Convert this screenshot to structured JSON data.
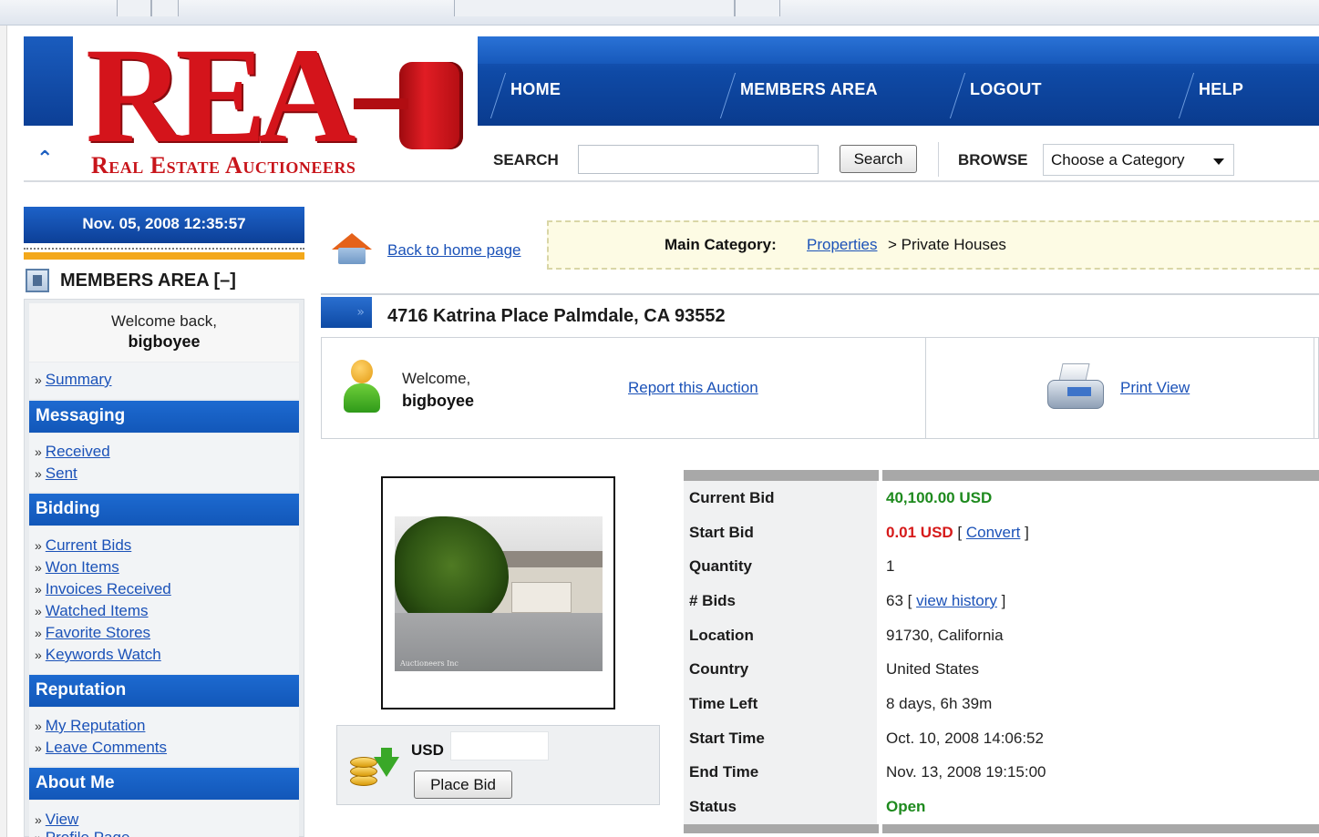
{
  "header": {
    "logo_text": "REA",
    "logo_subtitle": "Real Estate Auctioneers",
    "nav": [
      "HOME",
      "MEMBERS AREA",
      "LOGOUT",
      "HELP"
    ],
    "search_label": "SEARCH",
    "search_value": "",
    "search_button": "Search",
    "browse_label": "BROWSE",
    "category_selected": "Choose a Category"
  },
  "sidebar": {
    "datetime": "Nov. 05, 2008 12:35:57",
    "members_title": "MEMBERS AREA [–]",
    "welcome_line": "Welcome back,",
    "username": "bigboyee",
    "summary_link": "Summary",
    "sections": [
      {
        "title": "Messaging",
        "links": [
          "Received",
          "Sent"
        ]
      },
      {
        "title": "Bidding",
        "links": [
          "Current Bids",
          "Won Items",
          "Invoices Received",
          "Watched Items",
          "Favorite Stores",
          "Keywords Watch"
        ]
      },
      {
        "title": "Reputation",
        "links": [
          "My Reputation",
          "Leave Comments"
        ]
      },
      {
        "title": "About Me",
        "links": [
          "View",
          "Profile Page"
        ]
      }
    ]
  },
  "main": {
    "back_link": "Back to home page",
    "category_label": "Main Category:",
    "category_link": "Properties",
    "category_rest": "> Private Houses",
    "title": "4716 Katrina Place Palmdale, CA 93552",
    "welcome_line": "Welcome,",
    "username": "bigboyee",
    "report_link": "Report this Auction",
    "print_link": "Print View",
    "photo_watermark": "Auctioneers Inc",
    "bid_currency": "USD",
    "bid_value": "",
    "place_bid_button": "Place Bid",
    "details": {
      "current_bid_label": "Current Bid",
      "current_bid": "40,100.00 USD",
      "start_bid_label": "Start Bid",
      "start_bid": "0.01 USD",
      "convert_link": "Convert",
      "quantity_label": "Quantity",
      "quantity": "1",
      "bids_label": "# Bids",
      "bids": "63",
      "history_link": "view history",
      "location_label": "Location",
      "location": "91730, California",
      "country_label": "Country",
      "country": "United States",
      "time_left_label": "Time Left",
      "time_left": "8 days, 6h 39m",
      "start_time_label": "Start Time",
      "start_time": "Oct. 10, 2008 14:06:52",
      "end_time_label": "End Time",
      "end_time": "Nov. 13, 2008 19:15:00",
      "status_label": "Status",
      "status": "Open"
    }
  },
  "colors": {
    "brand_red": "#d4141b",
    "nav_blue": "#0f4aa6",
    "link_blue": "#1b52b8",
    "bid_green": "#1e8a1e",
    "start_red": "#d61a1a",
    "accent_gold": "#f3a81b"
  }
}
